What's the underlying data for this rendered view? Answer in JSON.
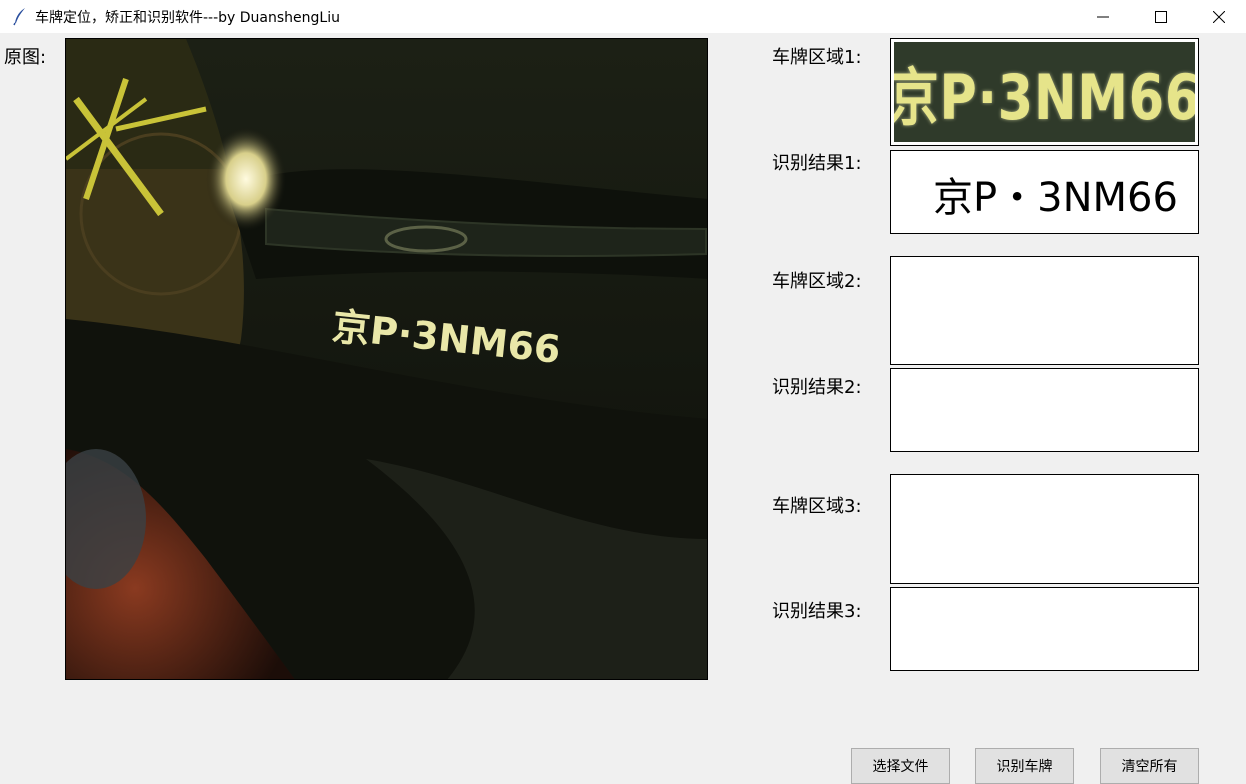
{
  "window": {
    "title": "车牌定位，矫正和识别软件---by DuanshengLiu",
    "controls": [
      "minimize-icon",
      "maximize-icon",
      "close-icon"
    ]
  },
  "original": {
    "label": "原图:",
    "plate_text_in_photo": "京P·3NM66"
  },
  "plates": [
    {
      "region_label": "车牌区域1:",
      "plate_image_text": "京P·3NM66",
      "result_label": "识别结果1:",
      "result": "京P・3NM66"
    },
    {
      "region_label": "车牌区域2:",
      "plate_image_text": "",
      "result_label": "识别结果2:",
      "result": ""
    },
    {
      "region_label": "车牌区域3:",
      "plate_image_text": "",
      "result_label": "识别结果3:",
      "result": ""
    }
  ],
  "buttons": {
    "select_file": "选择文件",
    "recognize": "识别车牌",
    "clear_all": "清空所有"
  }
}
